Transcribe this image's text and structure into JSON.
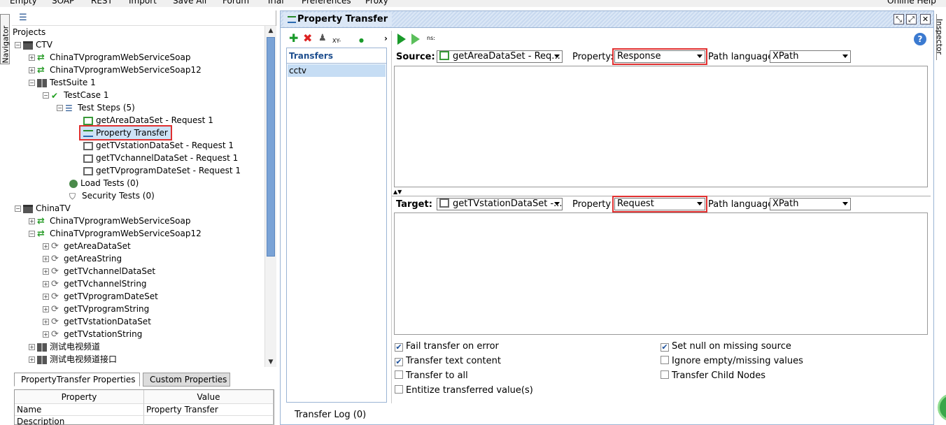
{
  "menubar": [
    "Empty",
    "SOAP",
    "REST",
    "Import",
    "Save All",
    "Forum",
    "Trial",
    "Preferences",
    "Proxy",
    "Online Help"
  ],
  "side_tabs": {
    "left": "Navigator",
    "right": "Inspector"
  },
  "navigator": {
    "tree": [
      {
        "label": "Projects",
        "icon": "none"
      },
      {
        "label": "CTV",
        "icon": "folder-icon"
      },
      {
        "label": "ChinaTVprogramWebServiceSoap",
        "icon": "interface-icon"
      },
      {
        "label": "ChinaTVprogramWebServiceSoap12",
        "icon": "interface-icon"
      },
      {
        "label": "TestSuite 1",
        "icon": "testsuite-icon"
      },
      {
        "label": "TestCase 1",
        "icon": "check-icon"
      },
      {
        "label": "Test Steps (5)",
        "icon": "list-icon"
      },
      {
        "label": "getAreaDataSet - Request 1",
        "icon": "request-step-icon"
      },
      {
        "label": "Property Transfer",
        "icon": "transfer-icon"
      },
      {
        "label": "getTVstationDataSet - Request 1",
        "icon": "request-step-icon"
      },
      {
        "label": "getTVchannelDataSet - Request 1",
        "icon": "request-step-icon"
      },
      {
        "label": "getTVprogramDateSet - Request 1",
        "icon": "request-step-icon"
      },
      {
        "label": "Load Tests (0)",
        "icon": "loadtest-icon"
      },
      {
        "label": "Security Tests (0)",
        "icon": "shield-icon"
      },
      {
        "label": "ChinaTV",
        "icon": "folder-icon"
      },
      {
        "label": "ChinaTVprogramWebServiceSoap",
        "icon": "interface-icon"
      },
      {
        "label": "ChinaTVprogramWebServiceSoap12",
        "icon": "interface-icon"
      },
      {
        "label": "getAreaDataSet",
        "icon": "operation-icon"
      },
      {
        "label": "getAreaString",
        "icon": "operation-icon"
      },
      {
        "label": "getTVchannelDataSet",
        "icon": "operation-icon"
      },
      {
        "label": "getTVchannelString",
        "icon": "operation-icon"
      },
      {
        "label": "getTVprogramDateSet",
        "icon": "operation-icon"
      },
      {
        "label": "getTVprogramString",
        "icon": "operation-icon"
      },
      {
        "label": "getTVstationDataSet",
        "icon": "operation-icon"
      },
      {
        "label": "getTVstationString",
        "icon": "operation-icon"
      },
      {
        "label": "测试电视频道",
        "icon": "testsuite-icon"
      },
      {
        "label": "测试电视频道接口",
        "icon": "testsuite-icon"
      }
    ]
  },
  "properties": {
    "tabs": [
      "PropertyTransfer Properties",
      "Custom Properties"
    ],
    "headers": [
      "Property",
      "Value"
    ],
    "rows": [
      {
        "name": "Name",
        "value": "Property Transfer"
      },
      {
        "name": "Description",
        "value": ""
      }
    ]
  },
  "editor": {
    "title": "Property Transfer",
    "left_toolbar_text": "XY-",
    "run_toolbar_text": "ns:",
    "transfers_header": "Transfers",
    "transfers": [
      "cctv"
    ],
    "source": {
      "label": "Source:",
      "step": "getAreaDataSet - Req...",
      "property_label": "Property:",
      "property": "Response",
      "path_label": "Path language:",
      "path_language": "XPath"
    },
    "target": {
      "label": "Target:",
      "step": "getTVstationDataSet -...",
      "property_label": "Property",
      "property": "Request",
      "path_label": "Path language:",
      "path_language": "XPath"
    },
    "options_left": [
      {
        "label": "Fail transfer on error",
        "checked": true
      },
      {
        "label": "Transfer text content",
        "checked": true
      },
      {
        "label": "Transfer to all",
        "checked": false
      },
      {
        "label": "Entitize transferred value(s)",
        "checked": false
      }
    ],
    "options_right": [
      {
        "label": "Set null on missing source",
        "checked": true
      },
      {
        "label": "Ignore empty/missing values",
        "checked": false
      },
      {
        "label": "Transfer Child Nodes",
        "checked": false
      }
    ],
    "log_tab": "Transfer Log (0)"
  },
  "colors": {
    "accent": "#1f4f8f",
    "highlight": "#e03030",
    "selection": "#cde3f7",
    "run": "#1a9a2a"
  }
}
